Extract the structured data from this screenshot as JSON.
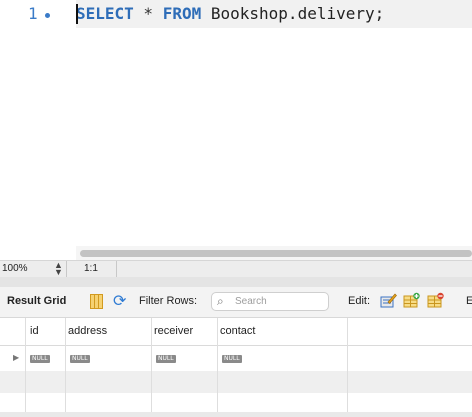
{
  "editor": {
    "line_number": "1",
    "code": {
      "kw1": "SELECT",
      "star": " * ",
      "kw2": "FROM",
      "rest": " Bookshop.delivery;"
    }
  },
  "statusbar": {
    "zoom": "100%",
    "position": "1:1"
  },
  "toolbar": {
    "title": "Result Grid",
    "filter_label": "Filter Rows:",
    "search_placeholder": "Search",
    "edit_label": "Edit:",
    "export_cut": "E"
  },
  "grid": {
    "columns": [
      "id",
      "address",
      "receiver",
      "contact"
    ],
    "rows": [
      [
        "NULL",
        "NULL",
        "NULL",
        "NULL"
      ]
    ]
  },
  "colors": {
    "keyword": "#2e6db8",
    "null_badge": "#8a8a8a",
    "refresh": "#2f7bd3"
  }
}
